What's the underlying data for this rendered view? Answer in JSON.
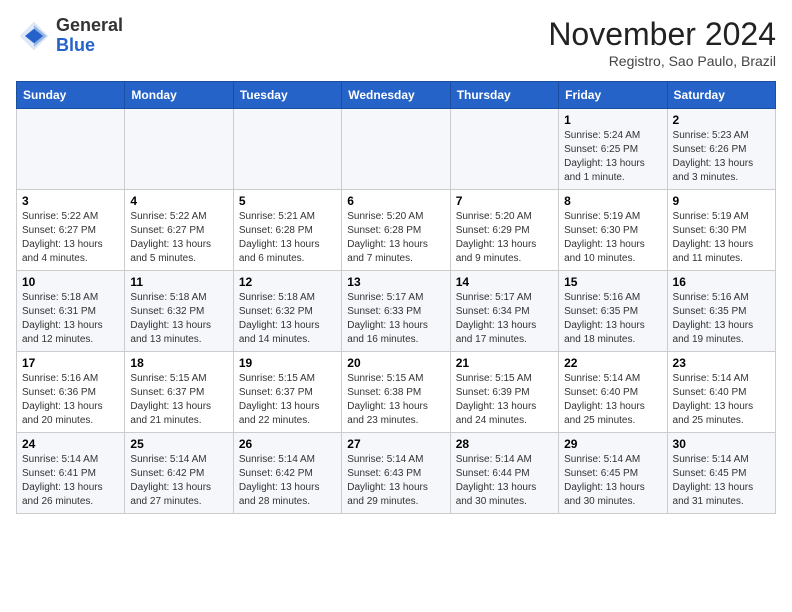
{
  "header": {
    "logo_general": "General",
    "logo_blue": "Blue",
    "month_title": "November 2024",
    "location": "Registro, Sao Paulo, Brazil"
  },
  "weekdays": [
    "Sunday",
    "Monday",
    "Tuesday",
    "Wednesday",
    "Thursday",
    "Friday",
    "Saturday"
  ],
  "weeks": [
    [
      {
        "day": "",
        "info": ""
      },
      {
        "day": "",
        "info": ""
      },
      {
        "day": "",
        "info": ""
      },
      {
        "day": "",
        "info": ""
      },
      {
        "day": "",
        "info": ""
      },
      {
        "day": "1",
        "info": "Sunrise: 5:24 AM\nSunset: 6:25 PM\nDaylight: 13 hours\nand 1 minute."
      },
      {
        "day": "2",
        "info": "Sunrise: 5:23 AM\nSunset: 6:26 PM\nDaylight: 13 hours\nand 3 minutes."
      }
    ],
    [
      {
        "day": "3",
        "info": "Sunrise: 5:22 AM\nSunset: 6:27 PM\nDaylight: 13 hours\nand 4 minutes."
      },
      {
        "day": "4",
        "info": "Sunrise: 5:22 AM\nSunset: 6:27 PM\nDaylight: 13 hours\nand 5 minutes."
      },
      {
        "day": "5",
        "info": "Sunrise: 5:21 AM\nSunset: 6:28 PM\nDaylight: 13 hours\nand 6 minutes."
      },
      {
        "day": "6",
        "info": "Sunrise: 5:20 AM\nSunset: 6:28 PM\nDaylight: 13 hours\nand 7 minutes."
      },
      {
        "day": "7",
        "info": "Sunrise: 5:20 AM\nSunset: 6:29 PM\nDaylight: 13 hours\nand 9 minutes."
      },
      {
        "day": "8",
        "info": "Sunrise: 5:19 AM\nSunset: 6:30 PM\nDaylight: 13 hours\nand 10 minutes."
      },
      {
        "day": "9",
        "info": "Sunrise: 5:19 AM\nSunset: 6:30 PM\nDaylight: 13 hours\nand 11 minutes."
      }
    ],
    [
      {
        "day": "10",
        "info": "Sunrise: 5:18 AM\nSunset: 6:31 PM\nDaylight: 13 hours\nand 12 minutes."
      },
      {
        "day": "11",
        "info": "Sunrise: 5:18 AM\nSunset: 6:32 PM\nDaylight: 13 hours\nand 13 minutes."
      },
      {
        "day": "12",
        "info": "Sunrise: 5:18 AM\nSunset: 6:32 PM\nDaylight: 13 hours\nand 14 minutes."
      },
      {
        "day": "13",
        "info": "Sunrise: 5:17 AM\nSunset: 6:33 PM\nDaylight: 13 hours\nand 16 minutes."
      },
      {
        "day": "14",
        "info": "Sunrise: 5:17 AM\nSunset: 6:34 PM\nDaylight: 13 hours\nand 17 minutes."
      },
      {
        "day": "15",
        "info": "Sunrise: 5:16 AM\nSunset: 6:35 PM\nDaylight: 13 hours\nand 18 minutes."
      },
      {
        "day": "16",
        "info": "Sunrise: 5:16 AM\nSunset: 6:35 PM\nDaylight: 13 hours\nand 19 minutes."
      }
    ],
    [
      {
        "day": "17",
        "info": "Sunrise: 5:16 AM\nSunset: 6:36 PM\nDaylight: 13 hours\nand 20 minutes."
      },
      {
        "day": "18",
        "info": "Sunrise: 5:15 AM\nSunset: 6:37 PM\nDaylight: 13 hours\nand 21 minutes."
      },
      {
        "day": "19",
        "info": "Sunrise: 5:15 AM\nSunset: 6:37 PM\nDaylight: 13 hours\nand 22 minutes."
      },
      {
        "day": "20",
        "info": "Sunrise: 5:15 AM\nSunset: 6:38 PM\nDaylight: 13 hours\nand 23 minutes."
      },
      {
        "day": "21",
        "info": "Sunrise: 5:15 AM\nSunset: 6:39 PM\nDaylight: 13 hours\nand 24 minutes."
      },
      {
        "day": "22",
        "info": "Sunrise: 5:14 AM\nSunset: 6:40 PM\nDaylight: 13 hours\nand 25 minutes."
      },
      {
        "day": "23",
        "info": "Sunrise: 5:14 AM\nSunset: 6:40 PM\nDaylight: 13 hours\nand 25 minutes."
      }
    ],
    [
      {
        "day": "24",
        "info": "Sunrise: 5:14 AM\nSunset: 6:41 PM\nDaylight: 13 hours\nand 26 minutes."
      },
      {
        "day": "25",
        "info": "Sunrise: 5:14 AM\nSunset: 6:42 PM\nDaylight: 13 hours\nand 27 minutes."
      },
      {
        "day": "26",
        "info": "Sunrise: 5:14 AM\nSunset: 6:42 PM\nDaylight: 13 hours\nand 28 minutes."
      },
      {
        "day": "27",
        "info": "Sunrise: 5:14 AM\nSunset: 6:43 PM\nDaylight: 13 hours\nand 29 minutes."
      },
      {
        "day": "28",
        "info": "Sunrise: 5:14 AM\nSunset: 6:44 PM\nDaylight: 13 hours\nand 30 minutes."
      },
      {
        "day": "29",
        "info": "Sunrise: 5:14 AM\nSunset: 6:45 PM\nDaylight: 13 hours\nand 30 minutes."
      },
      {
        "day": "30",
        "info": "Sunrise: 5:14 AM\nSunset: 6:45 PM\nDaylight: 13 hours\nand 31 minutes."
      }
    ]
  ]
}
